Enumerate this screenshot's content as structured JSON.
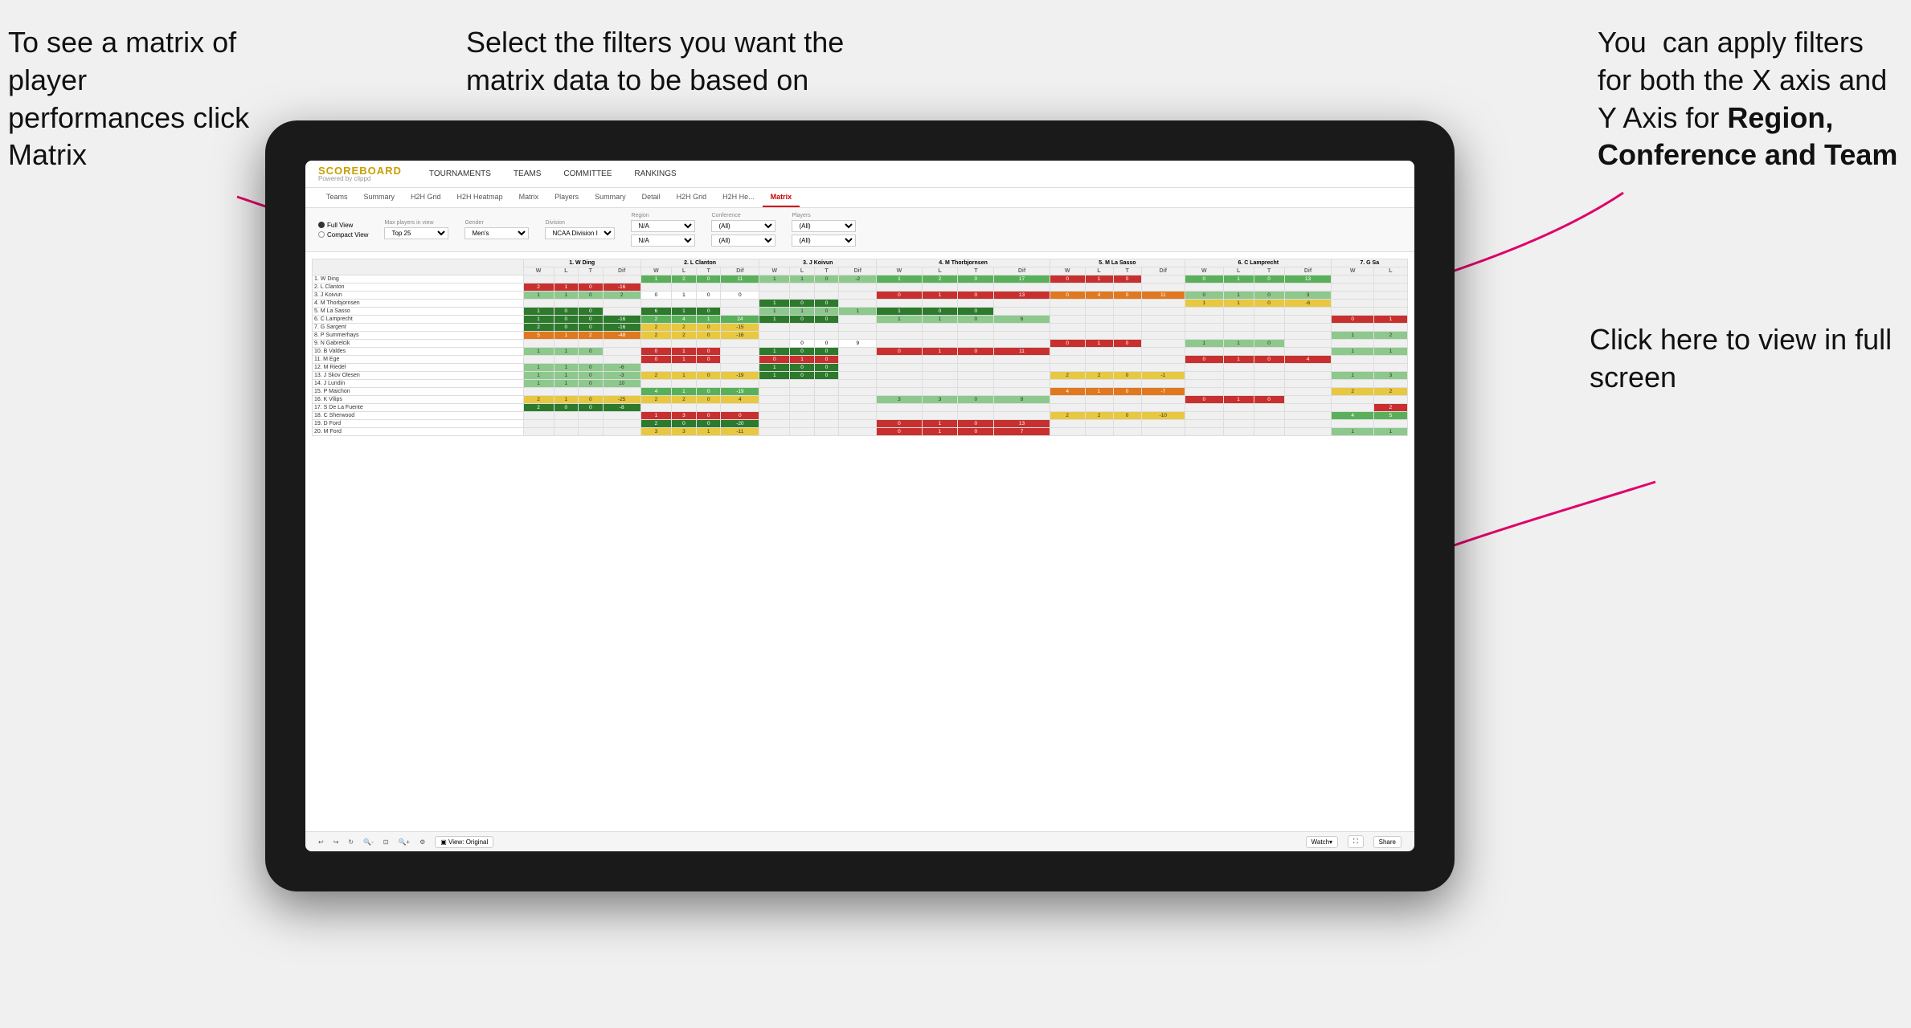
{
  "annotations": {
    "topleft": "To see a matrix of player performances click Matrix",
    "topleft_bold": "Matrix",
    "topcenter": "Select the filters you want the matrix data to be based on",
    "topright_line1": "You  can apply filters for both the X axis and Y Axis for ",
    "topright_bold": "Region, Conference and Team",
    "bottomright_line1": "Click here to view in full screen"
  },
  "nav": {
    "logo_title": "SCOREBOARD",
    "logo_sub": "Powered by clippd",
    "main_items": [
      "TOURNAMENTS",
      "TEAMS",
      "COMMITTEE",
      "RANKINGS"
    ],
    "sub_items": [
      "Teams",
      "Summary",
      "H2H Grid",
      "H2H Heatmap",
      "Matrix",
      "Players",
      "Summary",
      "Detail",
      "H2H Grid",
      "H2H He...",
      "Matrix"
    ],
    "active_tab": "Matrix"
  },
  "filters": {
    "view_options": [
      "Full View",
      "Compact View"
    ],
    "selected_view": "Full View",
    "max_players_label": "Max players in view",
    "max_players_value": "Top 25",
    "gender_label": "Gender",
    "gender_value": "Men's",
    "division_label": "Division",
    "division_value": "NCAA Division I",
    "region_label": "Region",
    "region_value": "N/A",
    "conference_label": "Conference",
    "conference_value": "(All)",
    "players_label": "Players",
    "players_value": "(All)"
  },
  "matrix": {
    "col_headers": [
      "1. W Ding",
      "2. L Clanton",
      "3. J Koivun",
      "4. M Thorbjornsen",
      "5. M La Sasso",
      "6. C Lamprecht",
      "7. G Sa"
    ],
    "sub_headers": [
      "W",
      "L",
      "T",
      "Dif"
    ],
    "rows": [
      {
        "name": "1. W Ding",
        "data": [
          [
            null,
            null,
            null,
            null
          ],
          [
            1,
            2,
            0,
            11
          ],
          [
            1,
            1,
            0,
            -2
          ],
          [
            1,
            2,
            0,
            17
          ],
          [
            0,
            1,
            0,
            null
          ],
          [
            0,
            1,
            0,
            13
          ],
          [
            null,
            null
          ]
        ],
        "highlight": false
      },
      {
        "name": "2. L Clanton",
        "data": [
          [
            2,
            1,
            0,
            -16
          ],
          [
            null,
            null,
            null,
            null
          ],
          [
            null,
            null,
            null,
            null
          ],
          [
            null,
            null,
            null,
            null
          ],
          [
            null,
            null,
            null,
            null
          ],
          [
            null,
            null,
            null,
            null
          ],
          [
            null,
            null
          ]
        ],
        "highlight": false
      },
      {
        "name": "3. J Koivun",
        "data": [
          [
            1,
            1,
            0,
            2
          ],
          [
            0,
            1,
            0,
            0
          ],
          [
            null,
            null,
            null,
            null
          ],
          [
            0,
            1,
            0,
            13
          ],
          [
            0,
            4,
            0,
            11
          ],
          [
            0,
            1,
            0,
            3
          ],
          [
            null,
            null
          ]
        ],
        "highlight": false
      },
      {
        "name": "4. M Thorbjornsen",
        "data": [
          [
            null,
            null,
            null,
            null
          ],
          [
            null,
            null,
            null,
            null
          ],
          [
            1,
            0,
            0,
            null
          ],
          [
            null,
            null,
            null,
            null
          ],
          [
            null,
            null,
            null,
            null
          ],
          [
            1,
            1,
            0,
            -6
          ],
          [
            null,
            null
          ]
        ],
        "highlight": false
      },
      {
        "name": "5. M La Sasso",
        "data": [
          [
            1,
            0,
            0,
            null
          ],
          [
            6,
            1,
            0,
            null
          ],
          [
            1,
            1,
            0,
            1
          ],
          [
            1,
            0,
            0,
            null
          ],
          [
            null,
            null,
            null,
            null
          ],
          [
            null,
            null,
            null,
            null
          ],
          [
            null,
            null
          ]
        ],
        "highlight": false
      },
      {
        "name": "6. C Lamprecht",
        "data": [
          [
            1,
            0,
            0,
            -16
          ],
          [
            2,
            4,
            1,
            24
          ],
          [
            1,
            0,
            0,
            null
          ],
          [
            1,
            1,
            0,
            6
          ],
          [
            null,
            null,
            null,
            null
          ],
          [
            null,
            null,
            null,
            null
          ],
          [
            0,
            1
          ]
        ],
        "highlight": false
      },
      {
        "name": "7. G Sargent",
        "data": [
          [
            2,
            0,
            0,
            -16
          ],
          [
            2,
            2,
            0,
            -15
          ],
          [
            null,
            null,
            null,
            null
          ],
          [
            null,
            null,
            null,
            null
          ],
          [
            null,
            null,
            null,
            null
          ],
          [
            null,
            null,
            null,
            null
          ],
          [
            null,
            null
          ]
        ],
        "highlight": false
      },
      {
        "name": "8. P Summerhays",
        "data": [
          [
            5,
            1,
            2,
            -48
          ],
          [
            2,
            2,
            0,
            -16
          ],
          [
            null,
            null,
            null,
            null
          ],
          [
            null,
            null,
            null,
            null
          ],
          [
            null,
            null,
            null,
            null
          ],
          [
            null,
            null,
            null,
            null
          ],
          [
            1,
            2
          ]
        ],
        "highlight": false
      },
      {
        "name": "9. N Gabrelcik",
        "data": [
          [
            null,
            null,
            null,
            null
          ],
          [
            null,
            null,
            null,
            null
          ],
          [
            null,
            0,
            0,
            9
          ],
          [
            null,
            null,
            null,
            null
          ],
          [
            0,
            1,
            0,
            null
          ],
          [
            1,
            1,
            0,
            null
          ],
          [
            null,
            null
          ]
        ],
        "highlight": false
      },
      {
        "name": "10. B Valdes",
        "data": [
          [
            1,
            1,
            0,
            null
          ],
          [
            0,
            1,
            0,
            null
          ],
          [
            1,
            0,
            0,
            null
          ],
          [
            0,
            1,
            0,
            11
          ],
          [
            null,
            null,
            null,
            null
          ],
          [
            null,
            null,
            null,
            null
          ],
          [
            1,
            1
          ]
        ],
        "highlight": false
      },
      {
        "name": "11. M Ege",
        "data": [
          [
            null,
            null,
            null,
            null
          ],
          [
            0,
            1,
            0,
            null
          ],
          [
            0,
            1,
            0,
            null
          ],
          [
            null,
            null,
            null,
            null
          ],
          [
            null,
            null,
            null,
            null
          ],
          [
            0,
            1,
            0,
            4
          ],
          [
            null,
            null
          ]
        ],
        "highlight": false
      },
      {
        "name": "12. M Riedel",
        "data": [
          [
            1,
            1,
            0,
            -6
          ],
          [
            null,
            null,
            null,
            null
          ],
          [
            1,
            0,
            0,
            null
          ],
          [
            null,
            null,
            null,
            null
          ],
          [
            null,
            null,
            null,
            null
          ],
          [
            null,
            null,
            null,
            null
          ],
          [
            null,
            null
          ]
        ],
        "highlight": false
      },
      {
        "name": "13. J Skov Olesen",
        "data": [
          [
            1,
            1,
            0,
            -3
          ],
          [
            2,
            1,
            0,
            -19
          ],
          [
            1,
            0,
            0,
            null
          ],
          [
            null,
            null,
            null,
            null
          ],
          [
            2,
            2,
            0,
            -1
          ],
          [
            null,
            null,
            null,
            null
          ],
          [
            1,
            3
          ]
        ],
        "highlight": false
      },
      {
        "name": "14. J Lundin",
        "data": [
          [
            1,
            1,
            0,
            10
          ],
          [
            null,
            null,
            null,
            null
          ],
          [
            null,
            null,
            null,
            null
          ],
          [
            null,
            null,
            null,
            null
          ],
          [
            null,
            null,
            null,
            null
          ],
          [
            null,
            null,
            null,
            null
          ],
          [
            null,
            null
          ]
        ],
        "highlight": false
      },
      {
        "name": "15. P Maichon",
        "data": [
          [
            null,
            null,
            null,
            null
          ],
          [
            4,
            1,
            0,
            -19
          ],
          [
            null,
            null,
            null,
            null
          ],
          [
            null,
            null,
            null,
            null
          ],
          [
            4,
            1,
            0,
            -7
          ],
          [
            null,
            null,
            null,
            null
          ],
          [
            2,
            2
          ]
        ],
        "highlight": false
      },
      {
        "name": "16. K Vilips",
        "data": [
          [
            2,
            1,
            0,
            -25
          ],
          [
            2,
            2,
            0,
            4
          ],
          [
            null,
            null,
            null,
            null
          ],
          [
            3,
            3,
            0,
            8
          ],
          [
            null,
            null,
            null,
            null
          ],
          [
            0,
            1,
            0,
            null
          ],
          [
            null,
            null
          ]
        ],
        "highlight": false
      },
      {
        "name": "17. S De La Fuente",
        "data": [
          [
            2,
            0,
            0,
            -8
          ],
          [
            null,
            null,
            null,
            null
          ],
          [
            null,
            null,
            null,
            null
          ],
          [
            null,
            null,
            null,
            null
          ],
          [
            null,
            null,
            null,
            null
          ],
          [
            null,
            null,
            null,
            null
          ],
          [
            null,
            2
          ]
        ],
        "highlight": false
      },
      {
        "name": "18. C Sherwood",
        "data": [
          [
            null,
            null,
            null,
            null
          ],
          [
            1,
            3,
            0,
            0
          ],
          [
            null,
            null,
            null,
            null
          ],
          [
            null,
            null,
            null,
            null
          ],
          [
            2,
            2,
            0,
            -10
          ],
          [
            null,
            null,
            null,
            null
          ],
          [
            4,
            5
          ]
        ],
        "highlight": false
      },
      {
        "name": "19. D Ford",
        "data": [
          [
            null,
            null,
            null,
            null
          ],
          [
            2,
            0,
            0,
            -20
          ],
          [
            null,
            null,
            null,
            null
          ],
          [
            0,
            1,
            0,
            13
          ],
          [
            null,
            null,
            null,
            null
          ],
          [
            null,
            null,
            null,
            null
          ],
          [
            null,
            null
          ]
        ],
        "highlight": false
      },
      {
        "name": "20. M Ford",
        "data": [
          [
            null,
            null,
            null,
            null
          ],
          [
            3,
            3,
            1,
            -11
          ],
          [
            null,
            null,
            null,
            null
          ],
          [
            0,
            1,
            0,
            7
          ],
          [
            null,
            null,
            null,
            null
          ],
          [
            null,
            null,
            null,
            null
          ],
          [
            1,
            1
          ]
        ],
        "highlight": false
      }
    ]
  },
  "toolbar": {
    "view_label": "View: Original",
    "watch_label": "Watch",
    "share_label": "Share"
  },
  "colors": {
    "accent_red": "#cc0000",
    "logo_gold": "#c8a000",
    "arrow_pink": "#e0006a"
  }
}
